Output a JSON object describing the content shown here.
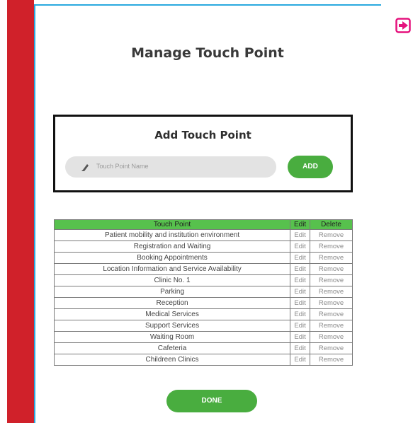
{
  "page": {
    "title": "Manage Touch Point",
    "logout_icon": "sign-out-icon"
  },
  "add_panel": {
    "title": "Add Touch Point",
    "input_placeholder": "Touch Point Name",
    "input_value": "",
    "input_icon": "pencil-icon",
    "add_label": "ADD"
  },
  "table": {
    "headers": [
      "Touch Point",
      "Edit",
      "Delete"
    ],
    "rows": [
      {
        "name": "Patient mobility and institution environment",
        "edit": "Edit",
        "remove": "Remove"
      },
      {
        "name": "Registration and Waiting",
        "edit": "Edit",
        "remove": "Remove"
      },
      {
        "name": "Booking Appointments",
        "edit": "Edit",
        "remove": "Remove"
      },
      {
        "name": "Location Information and Service Availability",
        "edit": "Edit",
        "remove": "Remove"
      },
      {
        "name": "Clinic No. 1",
        "edit": "Edit",
        "remove": "Remove"
      },
      {
        "name": "Parking",
        "edit": "Edit",
        "remove": "Remove"
      },
      {
        "name": "Reception",
        "edit": "Edit",
        "remove": "Remove"
      },
      {
        "name": "Medical Services",
        "edit": "Edit",
        "remove": "Remove"
      },
      {
        "name": "Support Services",
        "edit": "Edit",
        "remove": "Remove"
      },
      {
        "name": "Waiting Room",
        "edit": "Edit",
        "remove": "Remove"
      },
      {
        "name": "Cafeteria",
        "edit": "Edit",
        "remove": "Remove"
      },
      {
        "name": "Childreen Clinics",
        "edit": "Edit",
        "remove": "Remove"
      }
    ]
  },
  "done_label": "DONE",
  "colors": {
    "sidebar": "#d0212a",
    "panel_border": "#2aa9df",
    "accent_green": "#49ad3f",
    "header_green": "#57c14d",
    "logout_magenta": "#e5127d"
  }
}
